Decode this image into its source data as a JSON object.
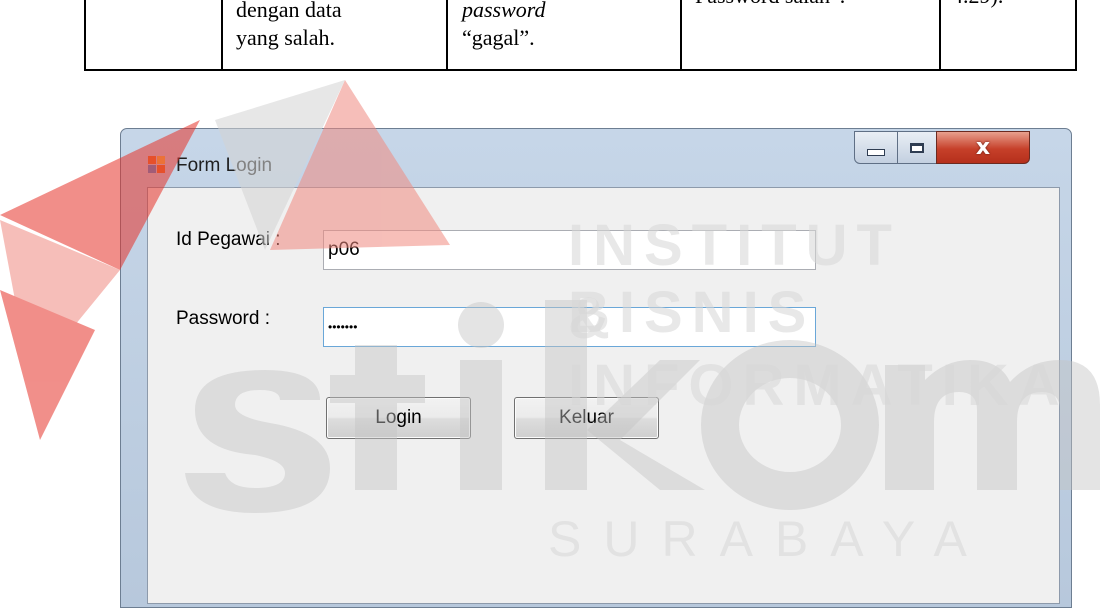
{
  "document_table": {
    "col2_lines": [
      "dengan data",
      "yang salah."
    ],
    "col3_line1": "password",
    "col3_line2": "“gagal”.",
    "col4_line1": "Password salah”.",
    "col5_line1": "4.29)."
  },
  "watermark": {
    "line1": "INSTITUT BISNIS",
    "line2": "& INFORMATIKA",
    "logo": "stikom",
    "city": "SURABAYA"
  },
  "window": {
    "title": "Form Login",
    "close_glyph": "x"
  },
  "form": {
    "id_label": "Id Pegawai :",
    "id_value": "p06",
    "password_label": "Password :",
    "password_value": "•••••••",
    "login_label": "Login",
    "exit_label": "Keluar"
  },
  "colors": {
    "window_frame": "#c6d6e8",
    "close_button": "#c6402a",
    "client_bg": "#f0f0f0",
    "watermark_red": "#e6332a"
  }
}
